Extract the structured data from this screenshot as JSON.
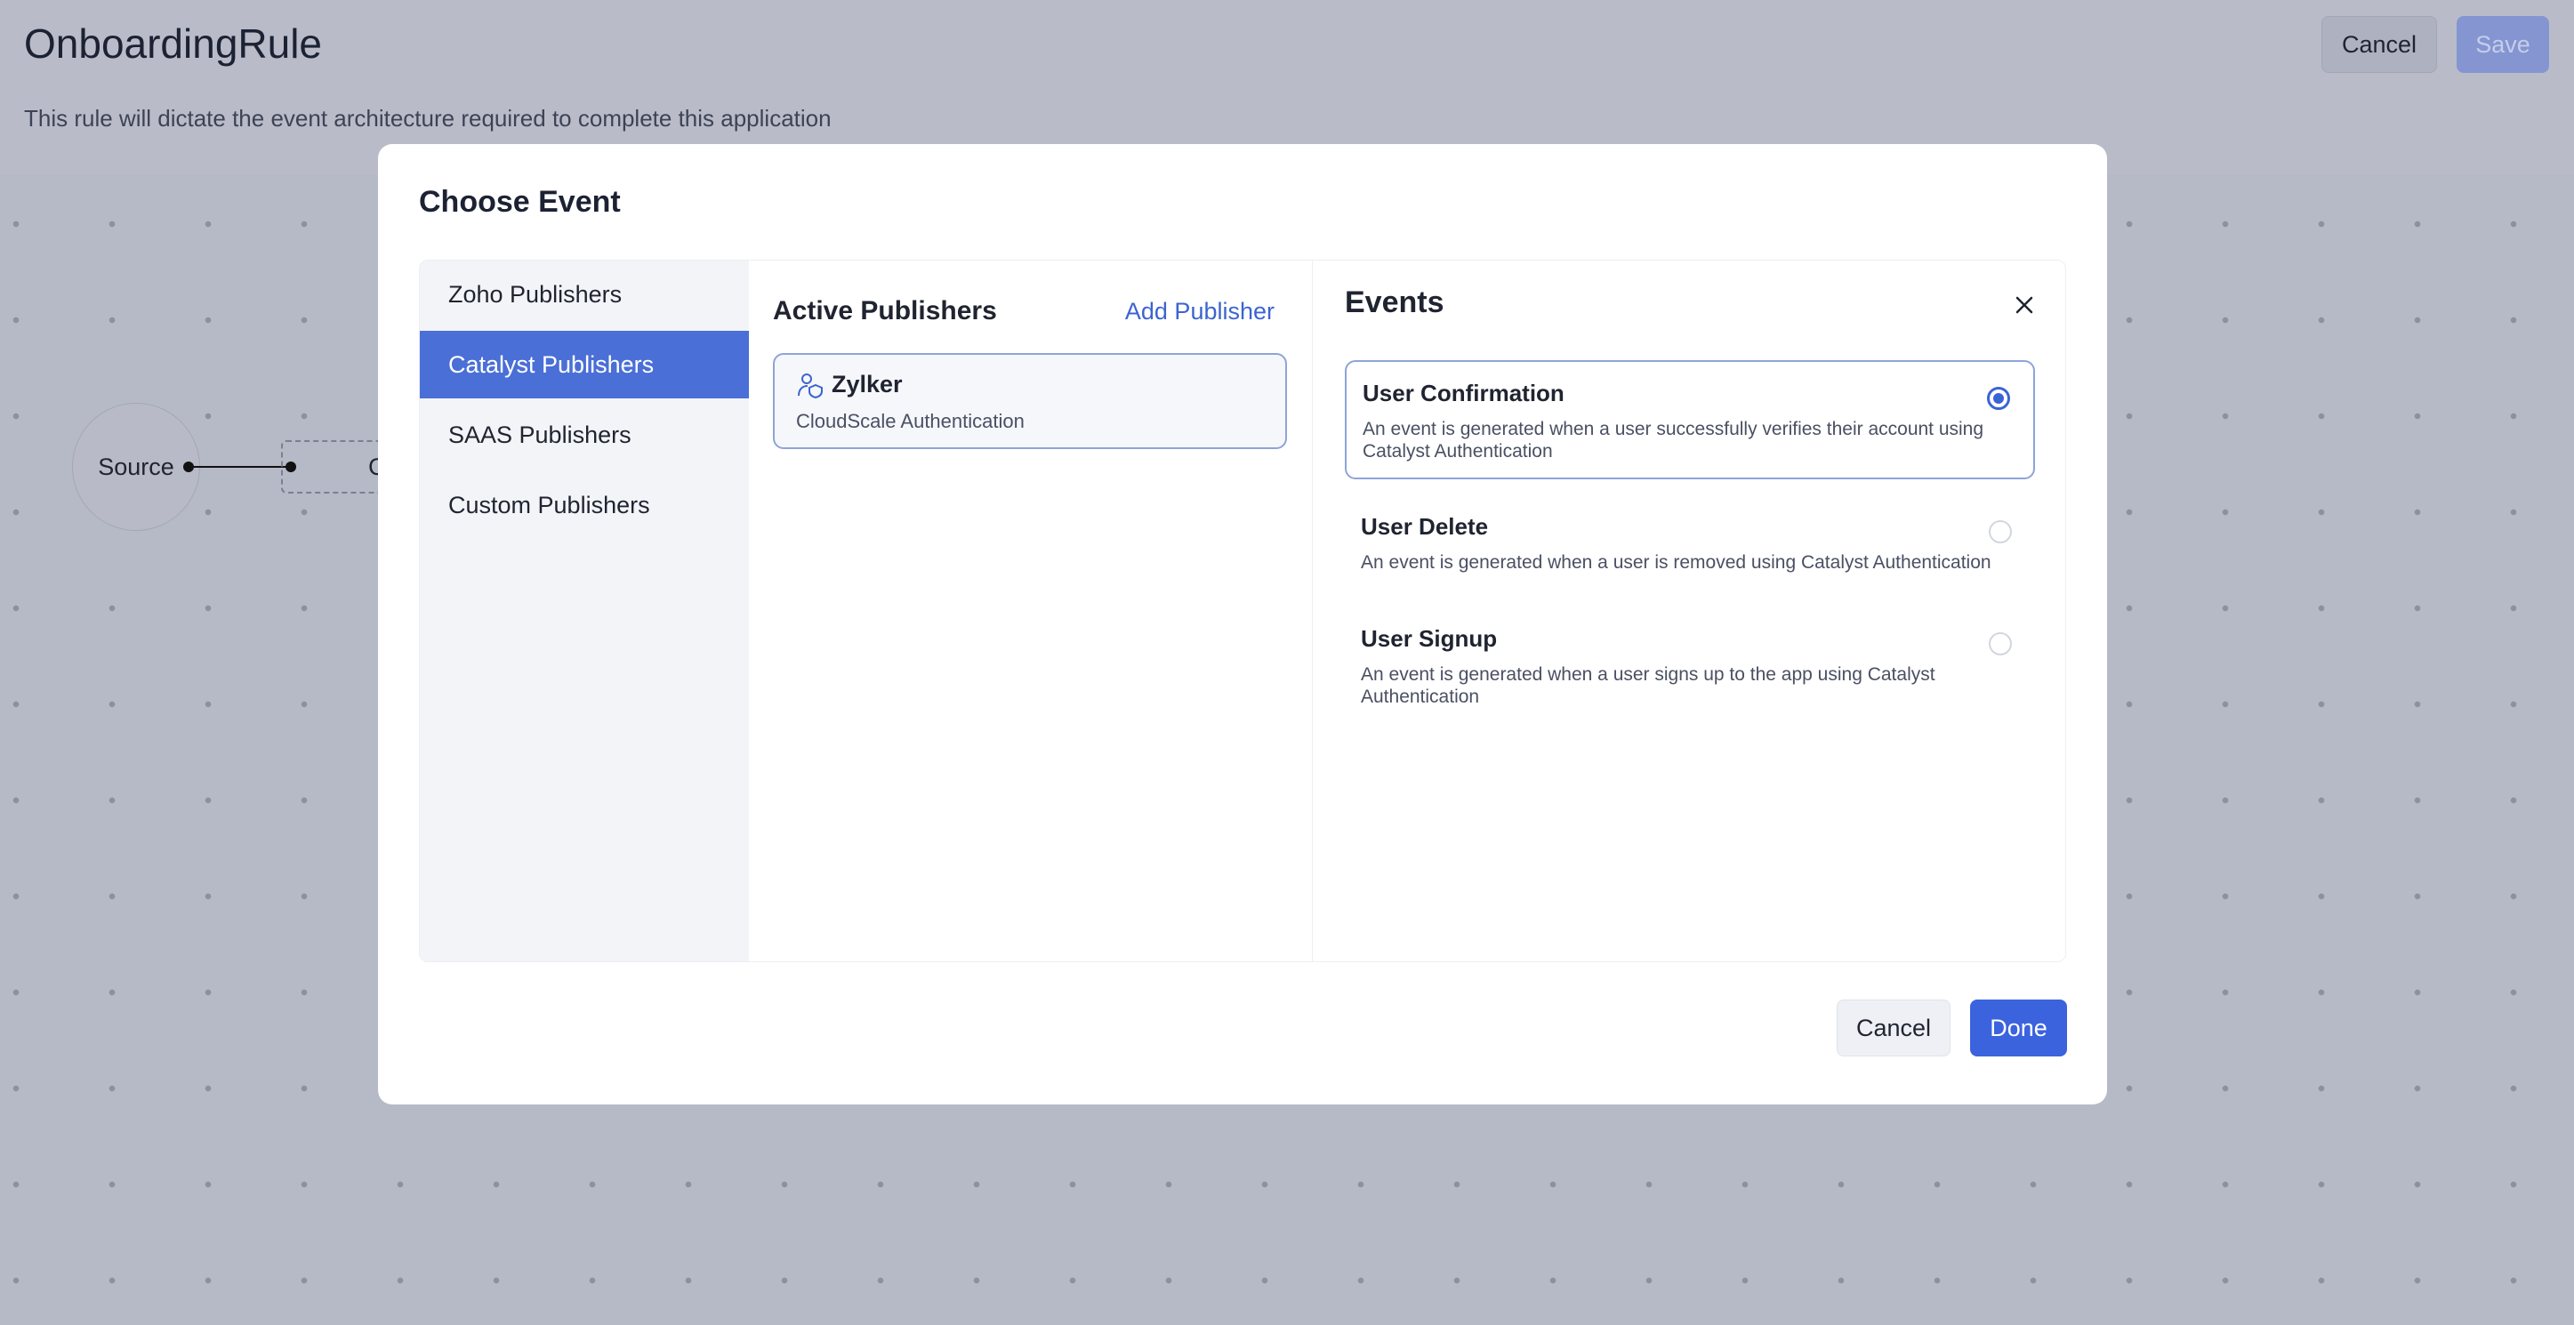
{
  "page": {
    "title": "OnboardingRule",
    "description": "This rule will dictate the event architecture required to complete this application",
    "cancel_label": "Cancel",
    "save_label": "Save"
  },
  "canvas": {
    "source_node_label": "Source",
    "next_node_label": "C"
  },
  "modal": {
    "title": "Choose Event",
    "publisher_categories": [
      {
        "label": "Zoho Publishers",
        "active": false
      },
      {
        "label": "Catalyst Publishers",
        "active": true
      },
      {
        "label": "SAAS Publishers",
        "active": false
      },
      {
        "label": "Custom Publishers",
        "active": false
      }
    ],
    "active_publishers": {
      "title": "Active Publishers",
      "add_label": "Add Publisher",
      "items": [
        {
          "name": "Zylker",
          "subtitle": "CloudScale Authentication",
          "icon": "user-shield-icon"
        }
      ]
    },
    "events": {
      "title": "Events",
      "items": [
        {
          "name": "User Confirmation",
          "description": "An event is generated when a user successfully verifies their account using Catalyst Authentication",
          "selected": true
        },
        {
          "name": "User Delete",
          "description": "An event is generated when a user is removed using Catalyst Authentication",
          "selected": false
        },
        {
          "name": "User Signup",
          "description": "An event is generated when a user signs up to the app using Catalyst Authentication",
          "selected": false
        }
      ]
    },
    "cancel_label": "Cancel",
    "done_label": "Done"
  },
  "colors": {
    "accent": "#3b63de",
    "active_nav": "#4a6fd6",
    "overlay_bg": "#b9bcc8"
  }
}
